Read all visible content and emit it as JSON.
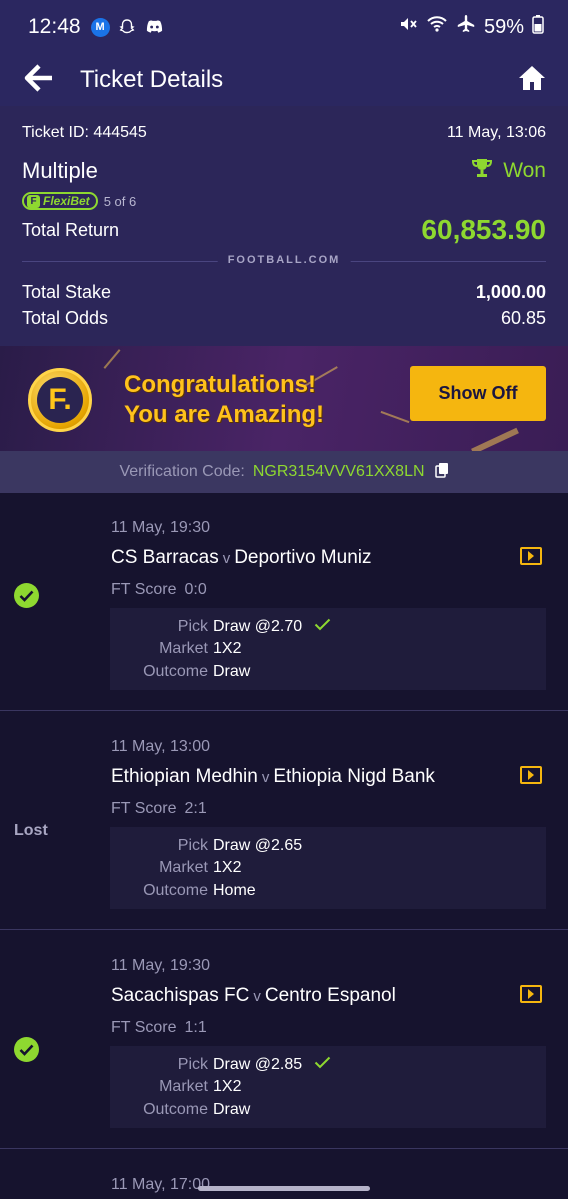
{
  "status_bar": {
    "time": "12:48",
    "m_badge": "M",
    "battery": "59%"
  },
  "app_bar": {
    "title": "Ticket Details",
    "back_icon": "back-arrow-icon",
    "home_icon": "home-icon"
  },
  "ticket": {
    "id_label": "Ticket ID: 444545",
    "date": "11 May, 13:06",
    "bet_type": "Multiple",
    "status": "Won",
    "flexi_label": "FlexiBet",
    "flexi_count": "5 of 6",
    "total_return_label": "Total Return",
    "total_return": "60,853.90",
    "brand": "FOOTBALL.COM",
    "total_stake_label": "Total Stake",
    "total_stake": "1,000.00",
    "total_odds_label": "Total Odds",
    "total_odds": "60.85"
  },
  "banner": {
    "line1": "Congratulations!",
    "line2": "You are Amazing!",
    "logo_letter": "F.",
    "button": "Show Off"
  },
  "verification": {
    "label": "Verification Code:",
    "code": "NGR3154VVV61XX8LN"
  },
  "labels": {
    "ft_score": "FT Score",
    "pick": "Pick",
    "market": "Market",
    "outcome": "Outcome",
    "v": "v"
  },
  "matches": [
    {
      "result": "won",
      "date": "11 May, 19:30",
      "home": "CS Barracas",
      "away": "Deportivo Muniz",
      "score": "0:0",
      "pick": "Draw @2.70",
      "pick_correct": true,
      "market": "1X2",
      "outcome": "Draw"
    },
    {
      "result": "lost",
      "result_label": "Lost",
      "date": "11 May, 13:00",
      "home": "Ethiopian Medhin",
      "away": "Ethiopia Nigd Bank",
      "score": "2:1",
      "pick": "Draw @2.65",
      "pick_correct": false,
      "market": "1X2",
      "outcome": "Home"
    },
    {
      "result": "won",
      "date": "11 May, 19:30",
      "home": "Sacachispas FC",
      "away": "Centro Espanol",
      "score": "1:1",
      "pick": "Draw @2.85",
      "pick_correct": true,
      "market": "1X2",
      "outcome": "Draw"
    },
    {
      "date": "11 May, 17:00"
    }
  ],
  "colors": {
    "accent_green": "#8ed830",
    "header_bg": "#2b2760",
    "body_bg": "#16132e",
    "button_yellow": "#f5b60f"
  }
}
